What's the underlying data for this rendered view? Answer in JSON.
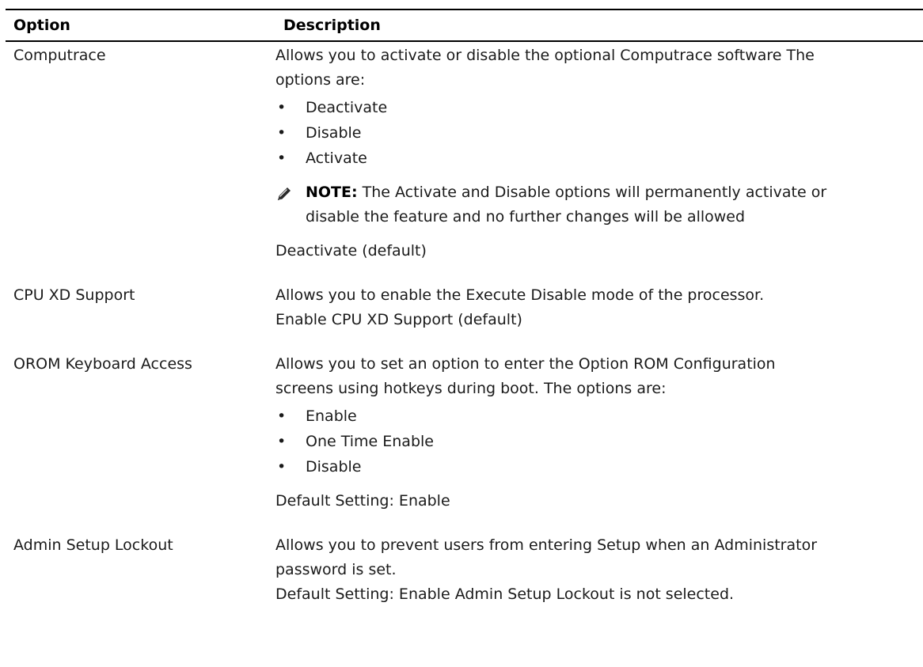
{
  "header": {
    "option": "Option",
    "description": "Description"
  },
  "rows": [
    {
      "option": "Computrace",
      "intro_line1": "Allows you to activate or disable the optional Computrace software The",
      "intro_line2": "options are:",
      "bullets": [
        "Deactivate",
        "Disable",
        "Activate"
      ],
      "note_label": "NOTE:",
      "note_line1": "The Activate and Disable options will permanently activate or",
      "note_line2": "disable the feature and no further changes will be allowed",
      "default": "Deactivate (default)"
    },
    {
      "option": "CPU XD Support",
      "intro_line1": "Allows you to enable the Execute Disable mode of the processor.",
      "default": "Enable CPU XD Support (default)"
    },
    {
      "option": "OROM Keyboard Access",
      "intro_line1": "Allows you to set an option to enter the Option ROM Configuration",
      "intro_line2": "screens using hotkeys during boot. The options are:",
      "bullets": [
        "Enable",
        "One Time Enable",
        "Disable"
      ],
      "default": "Default Setting: Enable"
    },
    {
      "option": "Admin Setup Lockout",
      "intro_line1": "Allows you to prevent users from entering Setup when an Administrator",
      "intro_line2": "password is set.",
      "default": "Default Setting: Enable Admin Setup Lockout is not selected."
    }
  ],
  "icons": {
    "note": "pencil-icon"
  }
}
